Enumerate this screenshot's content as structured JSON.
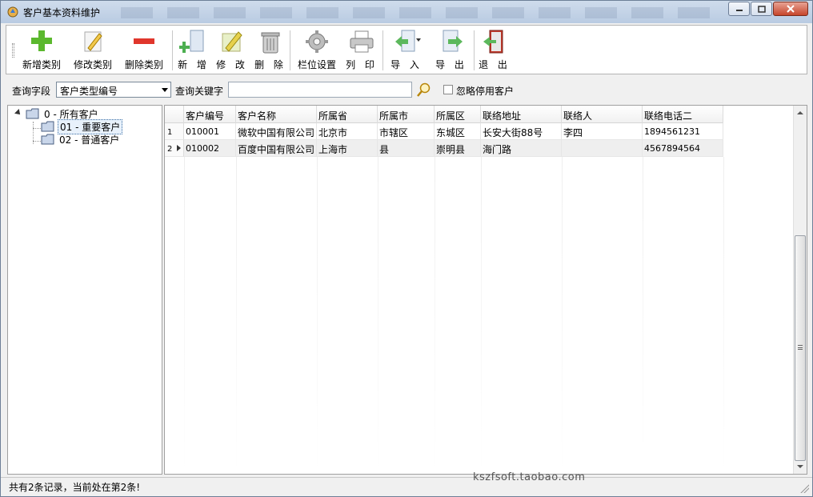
{
  "window": {
    "title": "客户基本资料维护",
    "accent": "#b9cbe2"
  },
  "toolbar": {
    "add_category": "新增类别",
    "edit_category": "修改类别",
    "delete_category": "删除类别",
    "add": "新 增",
    "edit": "修 改",
    "delete": "删 除",
    "column_settings": "栏位设置",
    "print": "列 印",
    "import": "导 入",
    "export": "导 出",
    "exit": "退 出"
  },
  "search": {
    "field_label": "查询字段",
    "field_value": "客户类型编号",
    "keyword_label": "查询关键字",
    "keyword_value": "",
    "ignore_disabled_label": "忽略停用客户",
    "ignore_disabled_checked": false
  },
  "tree": {
    "root": "0 - 所有客户",
    "children": [
      {
        "label": "01 - 重要客户",
        "selected": true
      },
      {
        "label": "02 - 普通客户",
        "selected": false
      }
    ]
  },
  "grid": {
    "columns": [
      "客户编号",
      "客户名称",
      "所属省",
      "所属市",
      "所属区",
      "联络地址",
      "联络人",
      "联络电话二"
    ],
    "rows": [
      {
        "num": "1",
        "cells": [
          "010001",
          "微软中国有限公司",
          "北京市",
          "市辖区",
          "东城区",
          "长安大街88号",
          "李四",
          "1894561231"
        ]
      },
      {
        "num": "2",
        "cells": [
          "010002",
          "百度中国有限公司",
          "上海市",
          "县",
          "崇明县",
          "海门路",
          "",
          "4567894564"
        ]
      }
    ],
    "current_row": 2
  },
  "status": {
    "text": "共有2条记录，当前处在第2条!",
    "watermark": "kszfsoft.taobao.com"
  }
}
